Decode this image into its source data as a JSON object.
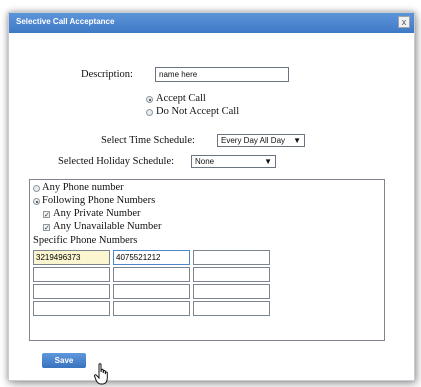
{
  "dialog": {
    "title": "Selective Call Acceptance",
    "close_label": "x"
  },
  "form": {
    "description_label": "Description:",
    "description_value": "name here",
    "radio_accept": "Accept Call",
    "radio_reject": "Do Not Accept Call",
    "time_schedule_label": "Select Time Schedule:",
    "time_schedule_value": "Every Day All Day",
    "holiday_schedule_label": "Selected Holiday Schedule:",
    "holiday_schedule_value": "None"
  },
  "numbers": {
    "any_number": "Any Phone number",
    "following_numbers": "Following Phone Numbers",
    "any_private": "Any Private Number",
    "any_unavailable": "Any Unavailable Number",
    "specific_label": "Specific Phone Numbers",
    "grid": [
      [
        "3219496373",
        "4075521212",
        ""
      ],
      [
        "",
        "",
        ""
      ],
      [
        "",
        "",
        ""
      ],
      [
        "",
        "",
        ""
      ]
    ]
  },
  "save_label": "Save",
  "colors": {
    "titlebar": "#4a86cf",
    "save_button": "#4a86cf",
    "filled_cell": "#fbf6cf"
  }
}
